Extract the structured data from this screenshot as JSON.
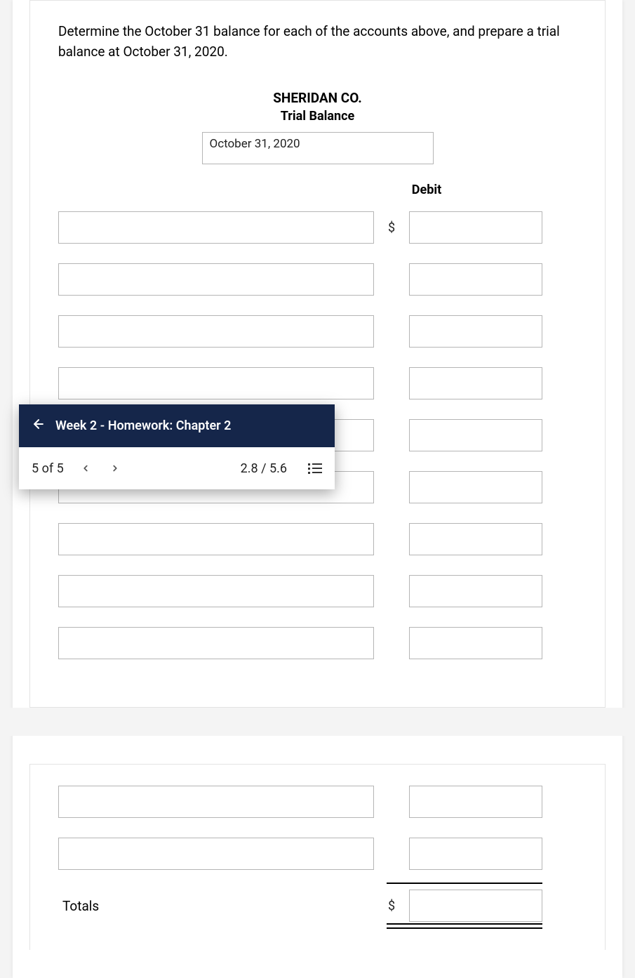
{
  "instruction": "Determine the October 31 balance for each of the accounts above, and prepare a trial balance at October 31, 2020.",
  "company": "SHERIDAN CO.",
  "report_label": "Trial Balance",
  "date_value": "October 31, 2020",
  "debit_header": "Debit",
  "dollar_sign": "$",
  "totals_label": "Totals",
  "nav": {
    "title": "Week 2 - Homework: Chapter 2",
    "count": "5 of 5",
    "score": "2.8 / 5.6"
  }
}
